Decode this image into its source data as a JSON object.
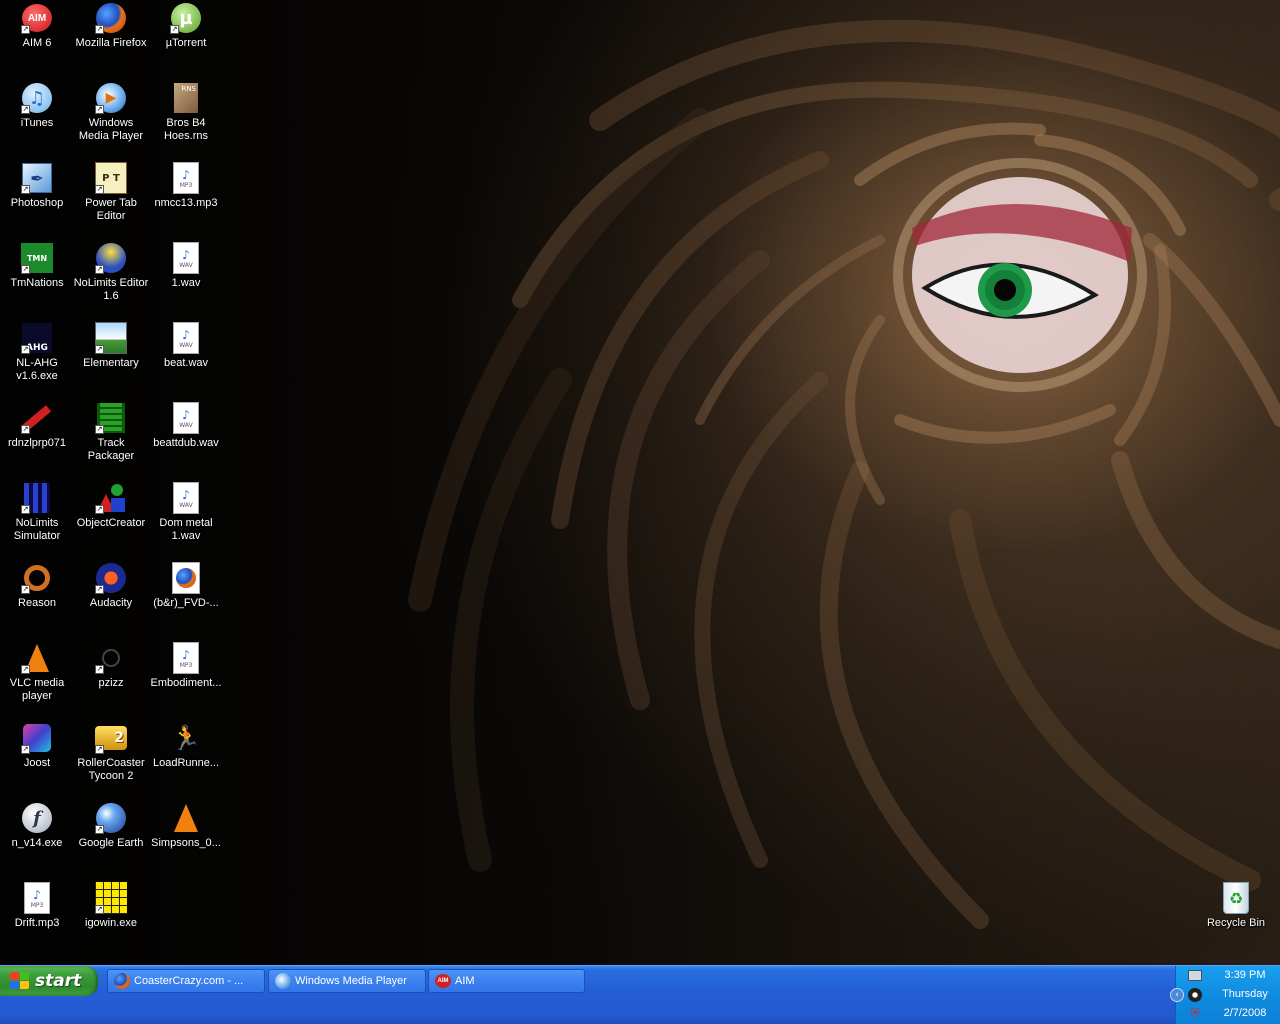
{
  "desktop": {
    "icons": [
      {
        "label": "AIM 6"
      },
      {
        "label": "Mozilla Firefox"
      },
      {
        "label": "µTorrent"
      },
      {
        "label": "iTunes"
      },
      {
        "label": "Windows Media Player"
      },
      {
        "label": "Bros B4 Hoes.rns"
      },
      {
        "label": "Photoshop"
      },
      {
        "label": "Power Tab Editor"
      },
      {
        "label": "nmcc13.mp3"
      },
      {
        "label": "TmNations"
      },
      {
        "label": "NoLimits Editor 1.6"
      },
      {
        "label": "1.wav"
      },
      {
        "label": "NL-AHG v1.6.exe"
      },
      {
        "label": "Elementary"
      },
      {
        "label": "beat.wav"
      },
      {
        "label": "rdnzlprp071"
      },
      {
        "label": "Track Packager"
      },
      {
        "label": "beattdub.wav"
      },
      {
        "label": "NoLimits Simulator"
      },
      {
        "label": "ObjectCreator"
      },
      {
        "label": "Dom metal 1.wav"
      },
      {
        "label": "Reason"
      },
      {
        "label": "Audacity"
      },
      {
        "label": "(b&r)_FVD-..."
      },
      {
        "label": "VLC media player"
      },
      {
        "label": "pzizz"
      },
      {
        "label": "Embodiment..."
      },
      {
        "label": "Joost"
      },
      {
        "label": "RollerCoaster Tycoon 2"
      },
      {
        "label": "LoadRunne..."
      },
      {
        "label": "n_v14.exe"
      },
      {
        "label": "Google Earth"
      },
      {
        "label": "Simpsons_0..."
      },
      {
        "label": "Drift.mp3"
      },
      {
        "label": "igowin.exe"
      }
    ],
    "recycle_bin": {
      "label": "Recycle Bin"
    },
    "icon_badges": {
      "aim": "AIM",
      "rns": "RNS",
      "mp3": "MP3",
      "wav": "WAV",
      "tmn": "TMN",
      "ahg": "AHG"
    }
  },
  "taskbar": {
    "start_label": "start",
    "buttons": [
      {
        "label": "CoasterCrazy.com - ..."
      },
      {
        "label": "Windows Media Player"
      },
      {
        "label": "AIM"
      }
    ],
    "aim_badge": "AIM"
  },
  "tray": {
    "time": "3:39 PM",
    "day": "Thursday",
    "date": "2/7/2008"
  },
  "colors": {
    "taskbar": "#245fd6",
    "start_button": "#3c9d3b",
    "tray": "#0f8be0",
    "eye_iris": "#1f9a4a"
  }
}
